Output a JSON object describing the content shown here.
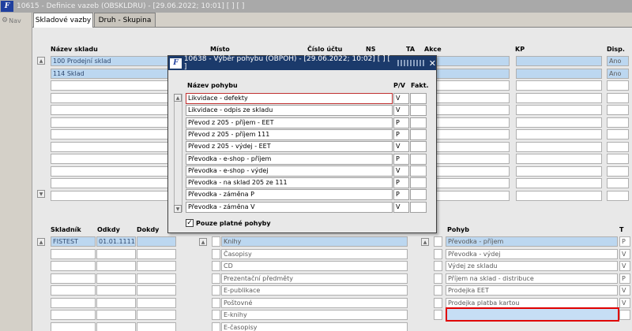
{
  "window": {
    "title": "10615 - Definice vazeb (OBSKLDRU) - [29.06.2022; 10:01] [ ] [ ]"
  },
  "nav": {
    "label": "Nav"
  },
  "tabs": [
    {
      "label": "Skladové vazby"
    },
    {
      "label": "Druh - Skupina"
    }
  ],
  "top_table": {
    "headers": {
      "nazev": "Název skladu",
      "misto": "Místo",
      "cislo": "Číslo účtu",
      "ns": "NS",
      "ta": "TA",
      "akce": "Akce",
      "kp": "KP",
      "disp": "Disp."
    },
    "rows": [
      {
        "nazev": "100 Prodejní sklad",
        "disp": "Ano"
      },
      {
        "nazev": "114 Sklad",
        "disp": "Ano"
      }
    ]
  },
  "dialog": {
    "title": "10638 - Výběr pohybu (OBPOH) - [29.06.2022; 10:02] [ ] [ ]",
    "headers": {
      "nazev": "Název pohybu",
      "pv": "P/V",
      "fakt": "Fakt."
    },
    "rows": [
      {
        "nazev": "Likvidace - defekty",
        "pv": "V"
      },
      {
        "nazev": "Likvidace - odpis ze skladu",
        "pv": "V"
      },
      {
        "nazev": "Převod z 205  - příjem - EET",
        "pv": "P"
      },
      {
        "nazev": "Převod z 205 - příjem 111",
        "pv": "P"
      },
      {
        "nazev": "Převod z 205 - výdej - EET",
        "pv": "V"
      },
      {
        "nazev": "Převodka - e-shop - příjem",
        "pv": "P"
      },
      {
        "nazev": "Převodka - e-shop - výdej",
        "pv": "V"
      },
      {
        "nazev": "Převodka - na sklad 205 ze 111",
        "pv": "P"
      },
      {
        "nazev": "Převodka - záměna P",
        "pv": "P"
      },
      {
        "nazev": "Převodka - záměna V",
        "pv": "V"
      }
    ],
    "checkbox_label": "Pouze platné pohyby",
    "checkbox_mark": "✓"
  },
  "bottom_left": {
    "headers": {
      "skladnik": "Skladník",
      "odkdy": "Odkdy",
      "dokdy": "Dokdy"
    },
    "rows": [
      {
        "skladnik": "FISTEST",
        "odkdy": "01.01.1111"
      }
    ]
  },
  "bottom_mid": {
    "rows": [
      "Knihy",
      "Časopisy",
      "CD",
      "Prezentační předměty",
      "E-publikace",
      "Poštovné",
      "E-knihy",
      "E-časopisy"
    ]
  },
  "bottom_right": {
    "headers": {
      "pohyb": "Pohyb",
      "t": "T"
    },
    "rows": [
      {
        "pohyb": "Převodka - příjem",
        "t": "P"
      },
      {
        "pohyb": "Převodka - výdej",
        "t": "V"
      },
      {
        "pohyb": "Výdej ze skladu",
        "t": "V"
      },
      {
        "pohyb": "Příjem na sklad - distribuce",
        "t": "P"
      },
      {
        "pohyb": "Prodejka EET",
        "t": "V"
      },
      {
        "pohyb": "Prodejka platba kartou",
        "t": "V"
      }
    ]
  }
}
